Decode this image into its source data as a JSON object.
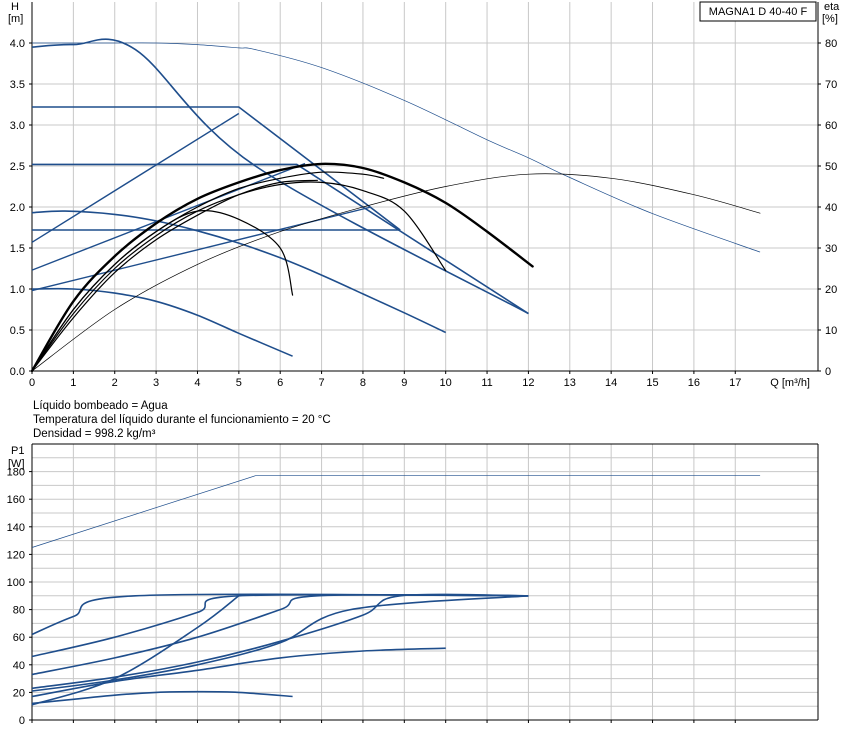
{
  "chart_data": [
    {
      "type": "line",
      "title": "MAGNA1 D 40-40 F",
      "xlabel": "Q [m³/h]",
      "ylabel": "H\n[m]",
      "y2label": "eta\n[%]",
      "xlim": [
        0,
        19
      ],
      "ylim": [
        0,
        4.5
      ],
      "y2lim": [
        0,
        90
      ],
      "xticks": [
        0,
        1,
        2,
        3,
        4,
        5,
        6,
        7,
        8,
        9,
        10,
        11,
        12,
        13,
        14,
        15,
        16,
        17
      ],
      "yticks": [
        0.0,
        0.5,
        1.0,
        1.5,
        2.0,
        2.5,
        3.0,
        3.5,
        4.0
      ],
      "ytick_labels": [
        "0.0",
        "0.5",
        "1.0",
        "1.5",
        "2.0",
        "2.5",
        "3.0",
        "3.5",
        "4.0"
      ],
      "y2ticks": [
        0,
        10,
        20,
        30,
        40,
        50,
        60,
        70,
        80
      ],
      "grid": true,
      "colors": {
        "blue": "#1f4e8c",
        "black": "#000000",
        "grid": "#c8c8c8"
      },
      "head_curves": [
        {
          "style": "blue",
          "x": [
            0,
            1,
            2.5,
            5.4,
            12.0
          ],
          "y": [
            3.95,
            3.98,
            3.92,
            2.5,
            0.7
          ]
        },
        {
          "style": "blue",
          "x": [
            0,
            5.0,
            8.9
          ],
          "y": [
            3.22,
            3.22,
            1.72
          ]
        },
        {
          "style": "blue",
          "x": [
            0,
            6.4,
            12.0
          ],
          "y": [
            2.52,
            2.52,
            0.7
          ]
        },
        {
          "style": "blue",
          "x": [
            0,
            8.9
          ],
          "y": [
            1.72,
            1.72
          ]
        },
        {
          "style": "blue",
          "x": [
            0,
            0.8,
            2,
            3,
            4,
            5,
            6,
            7,
            8,
            9,
            10
          ],
          "y": [
            1.93,
            1.95,
            1.91,
            1.83,
            1.71,
            1.56,
            1.38,
            1.17,
            0.94,
            0.71,
            0.47
          ]
        },
        {
          "style": "blue",
          "x": [
            0,
            1,
            2,
            3,
            4,
            5,
            6.3
          ],
          "y": [
            1.0,
            1.0,
            0.95,
            0.85,
            0.68,
            0.46,
            0.18
          ]
        },
        {
          "style": "thin",
          "x": [
            0,
            1,
            2,
            3,
            4,
            5,
            5.4,
            7,
            9,
            11,
            12,
            13,
            15,
            17.6
          ],
          "y": [
            4.0,
            4.0,
            4.0,
            4.0,
            3.98,
            3.94,
            3.92,
            3.7,
            3.3,
            2.82,
            2.6,
            2.36,
            1.92,
            1.45
          ]
        }
      ],
      "system_curves": [
        {
          "x": [
            0,
            5.0
          ],
          "y": [
            1.57,
            3.14
          ]
        },
        {
          "x": [
            0,
            6.6
          ],
          "y": [
            1.23,
            2.53
          ]
        },
        {
          "x": [
            0,
            8.2
          ],
          "y": [
            0.98,
            2.0
          ]
        }
      ],
      "efficiency_curves": [
        {
          "style": "bold",
          "x": [
            0,
            1,
            2,
            3,
            4,
            5,
            6,
            7,
            8,
            9,
            10,
            11,
            12.1
          ],
          "y": [
            0,
            17,
            28,
            36,
            42,
            46,
            49,
            50.5,
            49.5,
            46,
            41,
            34,
            25.5
          ]
        },
        {
          "style": "black",
          "x": [
            0,
            1,
            2,
            3,
            4,
            5,
            6,
            7,
            8,
            8.5
          ],
          "y": [
            0,
            15,
            26,
            34,
            40,
            44.5,
            47,
            48.5,
            48,
            47
          ]
        },
        {
          "style": "black",
          "x": [
            0,
            1,
            2,
            3,
            4,
            5,
            6,
            7,
            8,
            9,
            10
          ],
          "y": [
            0,
            14,
            25,
            33,
            39,
            43,
            45.5,
            46,
            44,
            39,
            24.5
          ]
        },
        {
          "style": "black",
          "x": [
            0,
            1,
            2,
            3,
            4,
            5,
            6,
            6.9
          ],
          "y": [
            0,
            13,
            24,
            32,
            38,
            43,
            46,
            46.5
          ]
        },
        {
          "style": "black",
          "x": [
            0,
            1,
            2,
            3,
            4,
            5,
            6,
            6.3
          ],
          "y": [
            0,
            15,
            26,
            34,
            39,
            37,
            30,
            18.5
          ]
        },
        {
          "style": "thin",
          "x": [
            0,
            2,
            4,
            6,
            8,
            10,
            12,
            14,
            16,
            17.6
          ],
          "y": [
            0,
            15,
            26,
            34,
            40,
            45,
            48,
            47,
            43,
            38.5
          ]
        }
      ]
    },
    {
      "type": "line",
      "title": "",
      "xlabel": "",
      "ylabel": "P1\n[W]",
      "xlim": [
        0,
        19
      ],
      "ylim": [
        0,
        200
      ],
      "yticks": [
        0,
        20,
        40,
        60,
        80,
        100,
        120,
        140,
        160,
        180
      ],
      "grid": true,
      "power_curves": [
        {
          "style": "thin",
          "x": [
            0,
            5.4,
            17.6
          ],
          "y": [
            125,
            177,
            177
          ]
        },
        {
          "style": "blue",
          "x": [
            0,
            1,
            2.5,
            12.0
          ],
          "y": [
            62,
            75,
            90,
            90
          ]
        },
        {
          "style": "blue",
          "x": [
            0,
            2,
            4,
            5,
            12.0
          ],
          "y": [
            46,
            60,
            78,
            90,
            90
          ]
        },
        {
          "style": "blue",
          "x": [
            0,
            2,
            4,
            6,
            6.9,
            12.0
          ],
          "y": [
            33,
            45,
            60,
            80,
            90,
            90
          ]
        },
        {
          "style": "blue",
          "x": [
            0,
            2,
            4,
            6,
            8,
            8.9,
            12.0
          ],
          "y": [
            23,
            31,
            42,
            57,
            76,
            90,
            90
          ]
        },
        {
          "style": "blue",
          "x": [
            0,
            2,
            4,
            6,
            7.7,
            12.0
          ],
          "y": [
            21,
            29,
            40,
            56,
            80,
            90
          ]
        },
        {
          "style": "blue",
          "x": [
            0,
            2,
            4,
            6,
            8,
            10
          ],
          "y": [
            17,
            28,
            36,
            45,
            50,
            52
          ]
        },
        {
          "style": "blue",
          "x": [
            0,
            1,
            2,
            3,
            4,
            5,
            6.3
          ],
          "y": [
            12,
            15,
            18,
            20,
            20.5,
            20,
            17
          ]
        },
        {
          "style": "blue",
          "x": [
            0,
            2,
            4,
            5.0
          ],
          "y": [
            11,
            30,
            67,
            90
          ]
        }
      ]
    }
  ],
  "labels": {
    "chart1_title": "MAGNA1 D 40-40 F",
    "h_axis_title": "H",
    "h_axis_unit": "[m]",
    "eta_axis_title": "eta",
    "eta_axis_unit": "[%]",
    "q_axis_label": "Q [m³/h]",
    "p1_axis_title": "P1",
    "p1_axis_unit": "[W]"
  },
  "conditions": {
    "liquid": "Líquido bombeado = Agua",
    "temperature": "Temperatura del líquido durante el funcionamiento = 20 °C",
    "density": "Densidad = 998.2 kg/m³"
  }
}
